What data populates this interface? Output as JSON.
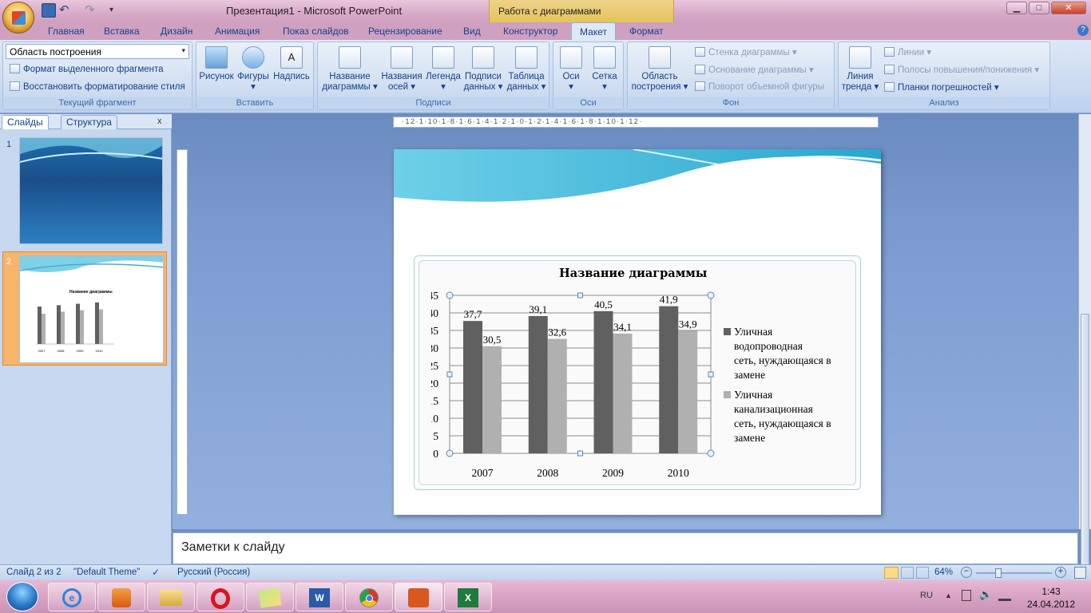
{
  "window": {
    "title": "Презентация1  -  Microsoft PowerPoint",
    "context_tab_title": "Работа с диаграммами",
    "minimize": "▁",
    "maximize": "□",
    "close": "✕"
  },
  "tabs": [
    "Главная",
    "Вставка",
    "Дизайн",
    "Анимация",
    "Показ слайдов",
    "Рецензирование",
    "Вид",
    "Конструктор",
    "Макет",
    "Формат"
  ],
  "active_tab": "Макет",
  "ribbon": {
    "current_fragment": {
      "combo_value": "Область построения",
      "format_selection": "Формат выделенного фрагмента",
      "reset_style": "Восстановить форматирование стиля",
      "label": "Текущий фрагмент"
    },
    "insert": {
      "picture": "Рисунок",
      "shapes": "Фигуры",
      "textbox": "Надпись",
      "label": "Вставить"
    },
    "labels": {
      "chart_title_1": "Название",
      "chart_title_2": "диаграммы",
      "axis_titles_1": "Названия",
      "axis_titles_2": "осей",
      "legend": "Легенда",
      "data_labels_1": "Подписи",
      "data_labels_2": "данных",
      "data_table_1": "Таблица",
      "data_table_2": "данных",
      "label": "Подписи"
    },
    "axes": {
      "axes": "Оси",
      "gridlines": "Сетка",
      "label": "Оси"
    },
    "background": {
      "plot_area_1": "Область",
      "plot_area_2": "построения",
      "chart_wall": "Стенка диаграммы",
      "chart_floor": "Основание диаграммы",
      "rotation": "Поворот объемной фигуры",
      "label": "Фон"
    },
    "analysis": {
      "trendline_1": "Линия",
      "trendline_2": "тренда",
      "lines": "Линии",
      "updown_bars": "Полосы повышения/понижения",
      "error_bars": "Планки погрешностей",
      "label": "Анализ"
    }
  },
  "left_panel": {
    "tab_slides": "Слайды",
    "tab_outline": "Структура",
    "close": "x",
    "slide_numbers": [
      "1",
      "2"
    ]
  },
  "thumb2": {
    "title": "Название диаграммы"
  },
  "ruler": {
    "h_ticks": "·12·1·10·1·8·1·6·1·4·1·2·1·0·1·2·1·4·1·6·1·8·1·10·1·12·"
  },
  "chart_data": {
    "type": "bar",
    "title": "Название диаграммы",
    "categories": [
      "2007",
      "2008",
      "2009",
      "2010"
    ],
    "series": [
      {
        "name": "Уличная водопроводная сеть, нуждающаяся в замене",
        "values": [
          37.7,
          39.1,
          40.5,
          41.9
        ],
        "color": "#606060",
        "labels": [
          "37,7",
          "39,1",
          "40,5",
          "41,9"
        ]
      },
      {
        "name": "Уличная канализационная сеть, нуждающаяся в замене",
        "values": [
          30.5,
          32.6,
          34.1,
          34.9
        ],
        "color": "#b0b0b0",
        "labels": [
          "30,5",
          "32,6",
          "34,1",
          "34,9"
        ]
      }
    ],
    "ylim": [
      0,
      45
    ],
    "yticks": [
      "0",
      "5",
      "10",
      "15",
      "20",
      "25",
      "30",
      "35",
      "40",
      "45"
    ],
    "grid": true,
    "legend": "right"
  },
  "legend_lines": {
    "s1": [
      "Уличная",
      "водопроводная",
      "сеть, нуждающаяся в",
      "замене"
    ],
    "s2": [
      "Уличная",
      "канализационная",
      "сеть, нуждающаяся в",
      "замене"
    ]
  },
  "notes": {
    "placeholder": "Заметки к слайду"
  },
  "status": {
    "slide": "Слайд 2 из 2",
    "theme": "\"Default Theme\"",
    "language": "Русский (Россия)",
    "zoom": "64%"
  },
  "tray": {
    "lang": "RU",
    "time": "1:43",
    "date": "24.04.2012"
  }
}
